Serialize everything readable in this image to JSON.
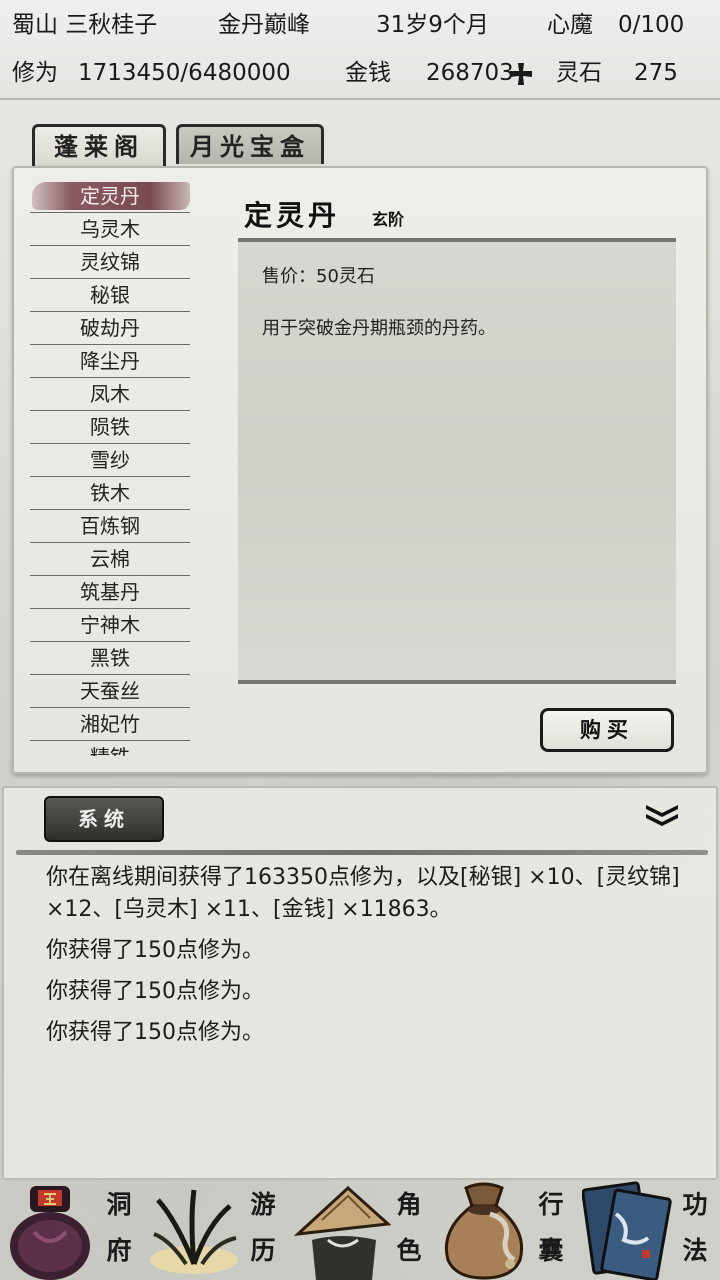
{
  "status": {
    "location": "蜀山 三秋桂子",
    "realm": "金丹巅峰",
    "age": "31岁9个月",
    "demon_label": "心魔",
    "demon_value": "0/100",
    "cultivation_label": "修为",
    "cultivation_value": "1713450/6480000",
    "money_label": "金钱",
    "money_value": "268703",
    "spirit_stone_label": "灵石",
    "spirit_stone_value": "275"
  },
  "tabs": [
    {
      "label": "蓬莱阁",
      "active": true
    },
    {
      "label": "月光宝盒",
      "active": false
    }
  ],
  "shop": {
    "items": [
      "定灵丹",
      "乌灵木",
      "灵纹锦",
      "秘银",
      "破劫丹",
      "降尘丹",
      "凤木",
      "陨铁",
      "雪纱",
      "铁木",
      "百炼钢",
      "云棉",
      "筑基丹",
      "宁神木",
      "黑铁",
      "天蚕丝",
      "湘妃竹",
      "精铁"
    ],
    "selected_index": 0,
    "detail": {
      "name": "定灵丹",
      "grade": "玄阶",
      "price": "售价：50灵石",
      "description": "用于突破金丹期瓶颈的丹药。"
    },
    "buy_label": "购买"
  },
  "log": {
    "tab_label": "系统",
    "lines": [
      "你在离线期间获得了163350点修为，以及[秘银] ×10、[灵纹锦] ×12、[乌灵木] ×11、[金钱] ×11863。",
      "你获得了150点修为。",
      "你获得了150点修为。",
      "你获得了150点修为。"
    ]
  },
  "nav": [
    {
      "label_top": "洞",
      "label_bottom": "府",
      "icon": "cave-bag-icon"
    },
    {
      "label_top": "游",
      "label_bottom": "历",
      "icon": "grass-icon"
    },
    {
      "label_top": "角",
      "label_bottom": "色",
      "icon": "straw-hat-icon"
    },
    {
      "label_top": "行",
      "label_bottom": "囊",
      "icon": "money-pouch-icon"
    },
    {
      "label_top": "功",
      "label_bottom": "法",
      "icon": "scroll-books-icon"
    }
  ],
  "colors": {
    "selected_item": "#7a4a52",
    "panel_bg": "#eeeee9",
    "dark_tab": "#3a3a36"
  }
}
